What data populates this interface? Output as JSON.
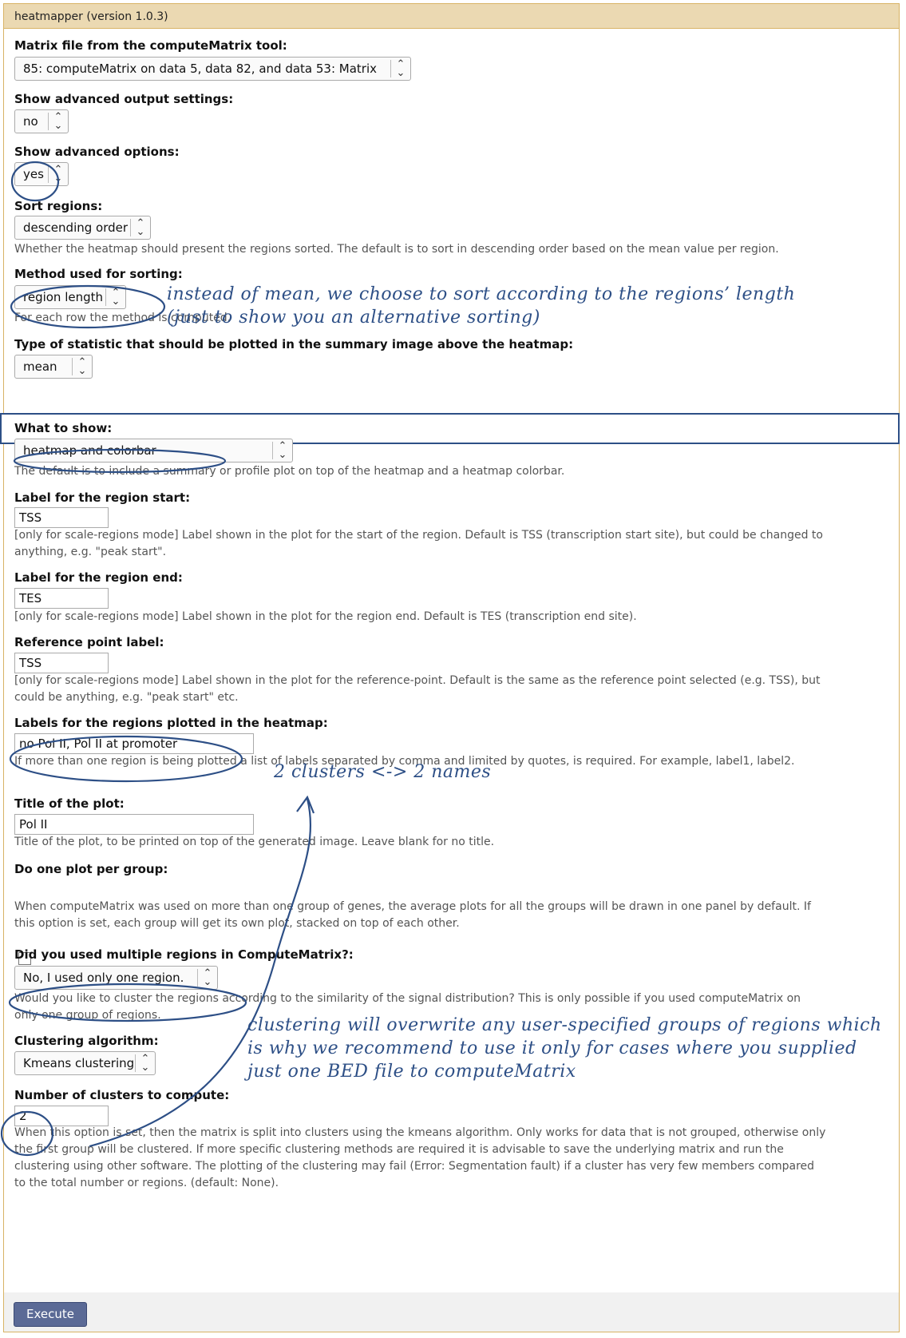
{
  "tool_title": "heatmapper (version 1.0.3)",
  "matrix": {
    "label": "Matrix file from the computeMatrix tool:",
    "value": "85: computeMatrix on data 5, data 82, and data 53: Matrix"
  },
  "adv_output": {
    "label": "Show advanced output settings:",
    "value": "no"
  },
  "adv_options": {
    "label": "Show advanced options:",
    "value": "yes"
  },
  "sort_regions": {
    "label": "Sort regions:",
    "value": "descending order",
    "help": "Whether the heatmap should present the regions sorted. The default is to sort in descending order based on the mean value per region."
  },
  "sort_method": {
    "label": "Method used for sorting:",
    "value": "region length",
    "help": "For each row the method is computed."
  },
  "statistic": {
    "label": "Type of statistic that should be plotted in the summary image above the heatmap:",
    "value": "mean"
  },
  "what_to_show": {
    "label": "What to show:",
    "value": "heatmap and colorbar",
    "help": "The default is to include a summary or profile plot on top of the heatmap and a heatmap colorbar."
  },
  "region_start": {
    "label": "Label for the region start:",
    "value": "TSS",
    "help": "[only for scale-regions mode] Label shown in the plot for the start of the region. Default is TSS (transcription start site), but could be changed to anything, e.g. \"peak start\"."
  },
  "region_end": {
    "label": "Label for the region end:",
    "value": "TES",
    "help": "[only for scale-regions mode] Label shown in the plot for the region end. Default is TES (transcription end site)."
  },
  "ref_point": {
    "label": "Reference point label:",
    "value": "TSS",
    "help": "[only for scale-regions mode] Label shown in the plot for the reference-point. Default is the same as the reference point selected (e.g. TSS), but could be anything, e.g. \"peak start\" etc."
  },
  "region_labels": {
    "label": "Labels for the regions plotted in the heatmap:",
    "value": "no Pol II, Pol II at promoter",
    "help": "If more than one region is being plotted a list of labels separated by comma and limited by quotes, is required. For example, label1, label2."
  },
  "plot_title": {
    "label": "Title of the plot:",
    "value": "Pol II",
    "help": "Title of the plot, to be printed on top of the generated image. Leave blank for no title."
  },
  "per_group": {
    "label": "Do one plot per group:",
    "help": "When computeMatrix was used on more than one group of genes, the average plots for all the groups will be drawn in one panel by default. If this option is set, each group will get its own plot, stacked on top of each other."
  },
  "multi_regions": {
    "label": "Did you used multiple regions in ComputeMatrix?:",
    "value": "No, I used only one region.",
    "help": "Would you like to cluster the regions according to the similarity of the signal distribution? This is only possible if you used computeMatrix on only one group of regions."
  },
  "cluster_alg": {
    "label": "Clustering algorithm:",
    "value": "Kmeans clustering"
  },
  "n_clusters": {
    "label": "Number of clusters to compute:",
    "value": "2",
    "help": "When this option is set, then the matrix is split into clusters using the kmeans algorithm. Only works for data that is not grouped, otherwise only the first group will be clustered. If more specific clustering methods are required it is advisable to save the underlying matrix and run the clustering using other software. The plotting of the clustering may fail (Error: Segmentation fault) if a cluster has very few members compared to the total number or regions. (default: None)."
  },
  "execute_label": "Execute",
  "annotations": {
    "sorting_line1": "instead of mean, we choose to sort according to the regions’ length",
    "sorting_line2": "(just to show you an alternative sorting)",
    "clusters_names": "2 clusters <-> 2 names",
    "clustering_line1": "clustering will overwrite any user-specified groups of regions which",
    "clustering_line2": "is why we recommend to use it only for cases where you supplied",
    "clustering_line3": "just one BED file to computeMatrix"
  },
  "colors": {
    "accent": "#2d4f86",
    "titlebar": "#ebd9b2",
    "button": "#5b6a96"
  }
}
